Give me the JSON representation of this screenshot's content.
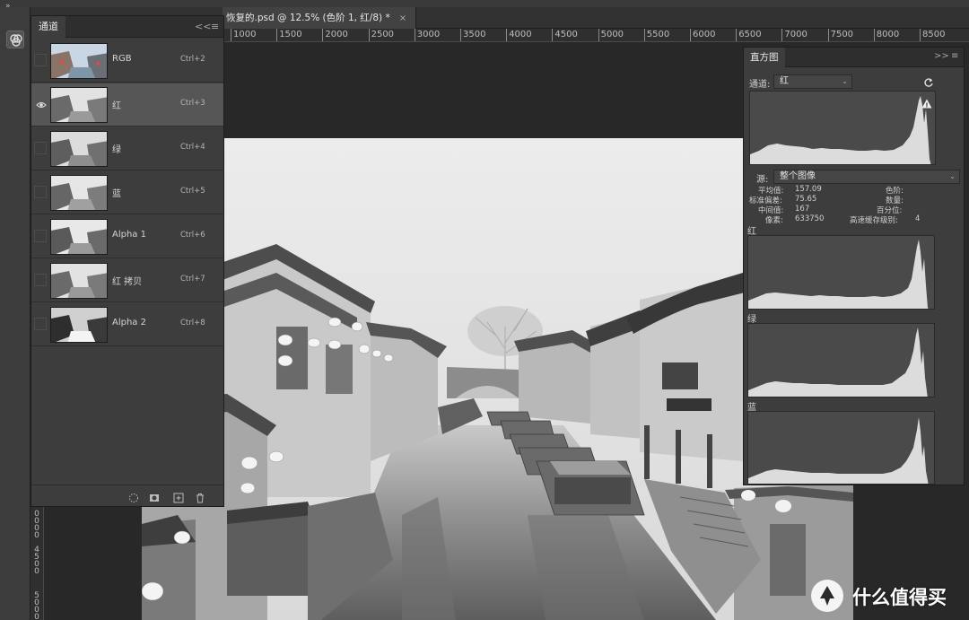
{
  "document": {
    "tab_title": "恢复的.psd @ 12.5% (色阶 1, 红/8) *",
    "close_glyph": "×"
  },
  "rulers": {
    "horizontal": [
      "1000",
      "1500",
      "2000",
      "2500",
      "3000",
      "3500",
      "4000",
      "4500",
      "5000",
      "5500",
      "6000",
      "6500",
      "7000",
      "7500",
      "8000",
      "8500"
    ],
    "vertical": [
      [
        "0",
        "0",
        "0",
        "0"
      ],
      [
        "4",
        "5",
        "0",
        "0"
      ],
      [
        "5",
        "0",
        "0",
        "0"
      ]
    ]
  },
  "channels_panel": {
    "tab_label": "通道",
    "collapse_glyph": "<<",
    "menu_glyph": "≡",
    "items": [
      {
        "name": "RGB",
        "shortcut": "Ctrl+2",
        "selected": false,
        "visible": false
      },
      {
        "name": "红",
        "shortcut": "Ctrl+3",
        "selected": true,
        "visible": true
      },
      {
        "name": "绿",
        "shortcut": "Ctrl+4",
        "selected": false,
        "visible": false
      },
      {
        "name": "蓝",
        "shortcut": "Ctrl+5",
        "selected": false,
        "visible": false
      },
      {
        "name": "Alpha 1",
        "shortcut": "Ctrl+6",
        "selected": false,
        "visible": false
      },
      {
        "name": "红 拷贝",
        "shortcut": "Ctrl+7",
        "selected": false,
        "visible": false
      },
      {
        "name": "Alpha 2",
        "shortcut": "Ctrl+8",
        "selected": false,
        "visible": false
      }
    ],
    "footer_icons": [
      "load-selection-icon",
      "save-selection-icon",
      "new-channel-icon",
      "delete-channel-icon"
    ]
  },
  "histogram_panel": {
    "tab_label": "直方图",
    "expand_glyph": ">>",
    "menu_glyph": "≡",
    "channel_label": "通道:",
    "channel_value": "红",
    "source_label": "源:",
    "source_value": "整个图像",
    "stats": {
      "mean_label": "平均值:",
      "mean_value": "157.09",
      "stddev_label": "标准偏差:",
      "stddev_value": "75.65",
      "median_label": "中间值:",
      "median_value": "167",
      "pixels_label": "像素:",
      "pixels_value": "633750",
      "level_label": "色阶:",
      "level_value": "",
      "count_label": "数量:",
      "count_value": "",
      "percentile_label": "百分位:",
      "percentile_value": "",
      "cache_label": "高速缓存级别:",
      "cache_value": "4"
    },
    "sub_channels": [
      {
        "label": "红"
      },
      {
        "label": "绿"
      },
      {
        "label": "蓝"
      }
    ],
    "warning_glyph": "!"
  },
  "watermark": {
    "text": "什么值得买"
  }
}
